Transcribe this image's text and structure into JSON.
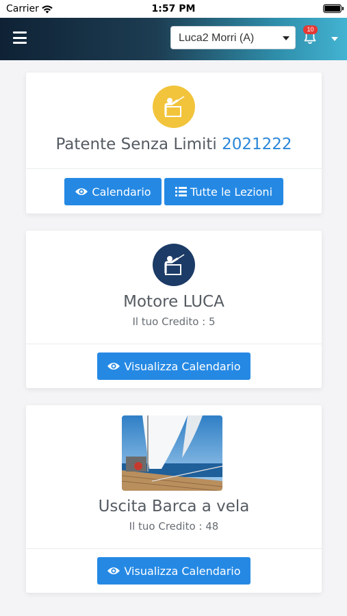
{
  "status_bar": {
    "carrier": "Carrier",
    "time": "1:57 PM"
  },
  "header": {
    "user_select_value": "Luca2 Morri (A)",
    "notification_count": "10"
  },
  "cards": [
    {
      "title": "Patente Senza Limiti",
      "title_accent": "2021222",
      "icon": "teacher-icon",
      "icon_bg": "#f2c43c",
      "buttons": [
        {
          "label": "Calendario",
          "icon": "eye-icon"
        },
        {
          "label": "Tutte le Lezioni",
          "icon": "list-icon"
        }
      ]
    },
    {
      "title": "Motore LUCA",
      "subtitle": "Il tuo Credito : 5",
      "icon": "teacher-icon",
      "icon_bg": "#1c3b66",
      "buttons": [
        {
          "label": "Visualizza Calendario",
          "icon": "eye-icon"
        }
      ]
    },
    {
      "title": "Uscita Barca a vela",
      "subtitle": "Il tuo Credito : 48",
      "image": "sailboat-photo",
      "buttons": [
        {
          "label": "Visualizza Calendario",
          "icon": "eye-icon"
        }
      ]
    }
  ],
  "colors": {
    "primary_button": "#2589e4",
    "accent_text": "#2a86d8",
    "badge": "#e53935"
  }
}
